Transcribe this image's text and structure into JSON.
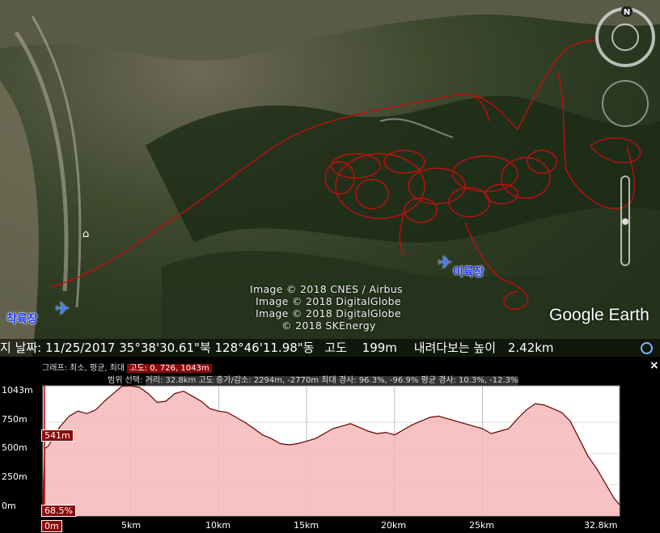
{
  "map": {
    "credits": [
      "Image © 2018 CNES / Airbus",
      "Image © 2018 DigitalGlobe",
      "Image © 2018 DigitalGlobe",
      "© 2018 SKEnergy"
    ],
    "logo": "Google Earth",
    "landing_label": "착륙장",
    "takeoff_label": "이륙장",
    "compass_letter": "N",
    "icons": [
      "airplane-icon",
      "airplane-icon",
      "museum-icon"
    ]
  },
  "status": {
    "date_label": "지 날짜:",
    "date_value": "11/25/2017",
    "lat": "35°38'30.61\"북",
    "lon": "128°46'11.98\"동",
    "alt_label": "고도",
    "alt_value": "199m",
    "eye_label": "내려다보는 높이",
    "eye_value": "2.42km"
  },
  "profile": {
    "graph_label": "그래프: 최소, 평균, 최대",
    "graph_value": "고도: 0, 726, 1043m",
    "range_label": "범위 선택:",
    "range_value": "거리: 32.8km 고도 증가/감소: 2294m, -2770m 최대 경사: 96.3%, -96.9% 평균 경사: 10.3%, -12.3%",
    "close": "×",
    "ylabels": [
      "1043m",
      "750m",
      "500m",
      "250m",
      "0m"
    ],
    "xlabels": [
      "0m",
      "5km",
      "10km",
      "15km",
      "20km",
      "25km",
      "32.8km"
    ],
    "cursor_alt": "541m",
    "cursor_slope": "68.5%"
  },
  "chart_data": {
    "type": "area",
    "xlabel": "",
    "ylabel": "",
    "xlim": [
      0,
      32.8
    ],
    "ylim": [
      0,
      1043
    ],
    "x": [
      0,
      0.1,
      0.3,
      1,
      1.5,
      2,
      2.5,
      3,
      3.5,
      4,
      4.5,
      5,
      5.5,
      6,
      6.5,
      7,
      7.5,
      8,
      8.5,
      9,
      9.5,
      10,
      10.5,
      11,
      11.5,
      12,
      12.5,
      13,
      13.5,
      14,
      14.5,
      15,
      15.5,
      16,
      16.5,
      17,
      17.5,
      18,
      18.5,
      19,
      19.5,
      20,
      20.5,
      21,
      21.5,
      22,
      22.5,
      23,
      23.5,
      24,
      24.5,
      25,
      25.5,
      26,
      26.5,
      27,
      27.5,
      28,
      28.5,
      29,
      29.5,
      30,
      30.5,
      31,
      31.5,
      32,
      32.5,
      32.8
    ],
    "series": [
      {
        "values": [
          0,
          541,
          560,
          720,
          800,
          840,
          820,
          850,
          920,
          980,
          1040,
          1043,
          1030,
          980,
          910,
          920,
          980,
          1000,
          960,
          920,
          860,
          840,
          830,
          790,
          750,
          700,
          650,
          620,
          580,
          570,
          580,
          600,
          620,
          660,
          700,
          720,
          740,
          710,
          680,
          660,
          670,
          650,
          690,
          730,
          760,
          790,
          800,
          780,
          760,
          740,
          720,
          700,
          660,
          680,
          700,
          780,
          850,
          900,
          890,
          860,
          830,
          760,
          620,
          480,
          380,
          260,
          140,
          90
        ]
      }
    ]
  }
}
